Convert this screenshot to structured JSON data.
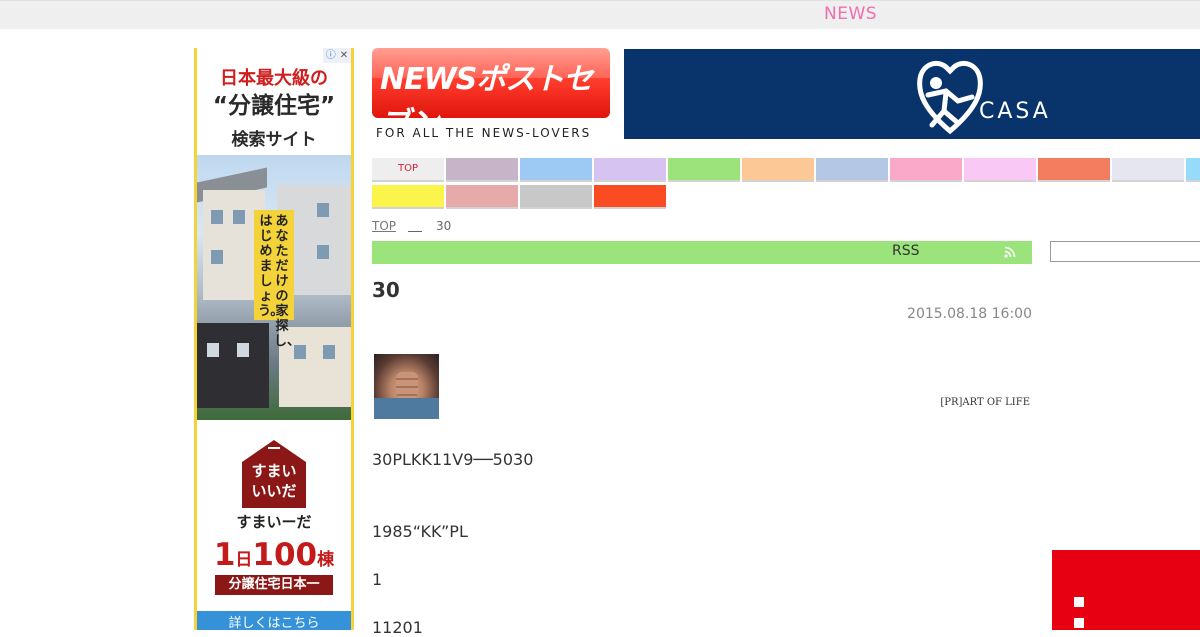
{
  "header": {
    "link_label": "NEWS"
  },
  "left_ad": {
    "adchoices": "ⓘ",
    "close": "✕",
    "headline1": "日本最大級の",
    "headline2": "“分譲住宅”",
    "headline3": "検索サイト",
    "vertical_right": "あなただけの家探し、",
    "vertical_left": "はじめましょう。",
    "logo_line1": "すまい",
    "logo_line2": "いいだ",
    "brand": "すまいーだ",
    "big_prefix": "1",
    "big_day": "日",
    "big_count": "100",
    "big_unit": "棟",
    "tagline": "分譲住宅日本一",
    "cta": "詳しくはこちら"
  },
  "logo": {
    "word": "NEWSポストセブン",
    "subtitle": "FOR ALL THE NEWS-LOVERS"
  },
  "banner": {
    "brand": "CASA"
  },
  "nav": {
    "tiles": [
      {
        "label": "TOP",
        "color": "#eeeeee"
      },
      {
        "label": "",
        "color": "#c8b4c8"
      },
      {
        "label": "",
        "color": "#9ccaf5"
      },
      {
        "label": "",
        "color": "#d7c3f2"
      },
      {
        "label": "",
        "color": "#9be37a"
      },
      {
        "label": "",
        "color": "#fcc896"
      },
      {
        "label": "",
        "color": "#b4c8e6"
      },
      {
        "label": "",
        "color": "#faaac8"
      },
      {
        "label": "",
        "color": "#fac8f5"
      },
      {
        "label": "",
        "color": "#f57d5f"
      },
      {
        "label": "",
        "color": "#e6e6f0"
      },
      {
        "label": "",
        "color": "#96dcfa"
      },
      {
        "label": "",
        "color": "#fbf54b"
      },
      {
        "label": "",
        "color": "#e6aaaa"
      },
      {
        "label": "",
        "color": "#c8c8c8"
      },
      {
        "label": "",
        "color": "#fa4b23"
      }
    ]
  },
  "breadcrumb": {
    "top": "TOP",
    "current": "30"
  },
  "section_bar": {
    "label": "RSS",
    "color": "#9be47c"
  },
  "search": {
    "placeholder": ""
  },
  "article": {
    "title": "30",
    "date": "2015.08.18 16:00",
    "pr_label": "[PR]ART OF LIFE",
    "paragraphs": [
      "30PLKK11V9──5030",
      "1985“KK”PL",
      "1",
      "11201"
    ]
  }
}
